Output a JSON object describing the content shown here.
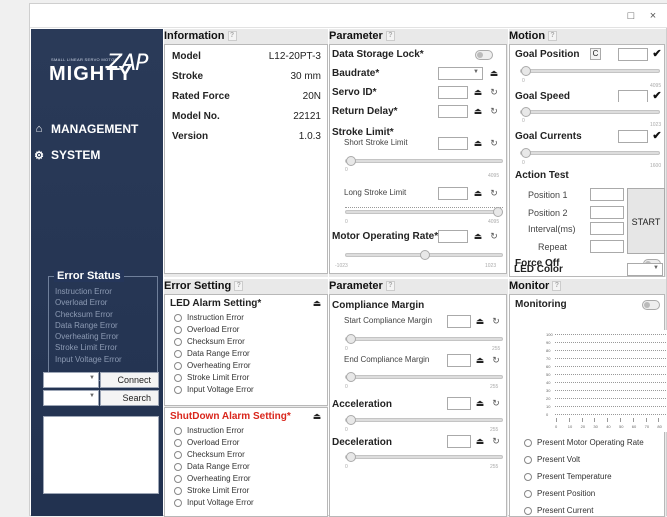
{
  "window": {
    "maximize_icon": "□",
    "close_icon": "×"
  },
  "sidebar": {
    "logo_small": "SMALL LINEAR SERVO MOTOR",
    "logo_text": "MIGHTY",
    "logo_zap": "ZAP",
    "nav": [
      {
        "label": "MANAGEMENT",
        "icon": "home-icon",
        "glyph": "⌂"
      },
      {
        "label": "SYSTEM",
        "icon": "gears-icon",
        "glyph": "⚙"
      }
    ],
    "error_status": {
      "title": "Error Status",
      "items": [
        "Instruction Error",
        "Overload Error",
        "Checksum Error",
        "Data Range Error",
        "Overheating Error",
        "Stroke Limit Error",
        "Input Voltage Error"
      ]
    },
    "connect_label": "Connect",
    "search_label": "Search"
  },
  "information": {
    "title": "Information",
    "rows": [
      {
        "label": "Model",
        "value": "L12-20PT-3"
      },
      {
        "label": "Stroke",
        "value": "30 mm"
      },
      {
        "label": "Rated Force",
        "value": "20N"
      },
      {
        "label": "Model No.",
        "value": "22121"
      },
      {
        "label": "Version",
        "value": "1.0.3"
      }
    ]
  },
  "parameter1": {
    "title": "Parameter",
    "data_storage_lock": "Data Storage Lock*",
    "baudrate": "Baudrate*",
    "servo_id": "Servo ID*",
    "return_delay": "Return Delay*",
    "stroke_limit": "Stroke Limit*",
    "short_stroke_limit": "Short Stroke Limit",
    "long_stroke_limit": "Long Stroke Limit",
    "motor_operating_rate": "Motor Operating Rate*",
    "short_min": "0",
    "short_max": "4095",
    "long_min": "0",
    "long_max": "4095",
    "mor_min": "-1023",
    "mor_max": "1023"
  },
  "motion": {
    "title": "Motion",
    "goal_position": "Goal Position",
    "goal_position_btn": "C",
    "goal_position_min": "0",
    "goal_position_max": "4095",
    "goal_speed": "Goal Speed",
    "goal_speed_min": "0",
    "goal_speed_max": "1023",
    "goal_currents": "Goal Currents",
    "goal_currents_min": "0",
    "goal_currents_max": "1600",
    "action_test": "Action Test",
    "position1": "Position 1",
    "position2": "Position 2",
    "interval": "Interval(ms)",
    "repeat": "Repeat",
    "start": "START",
    "force_off": "Force Off",
    "led_color": "LED Color"
  },
  "error_setting": {
    "title": "Error Setting",
    "led_alarm": "LED Alarm Setting*",
    "led_items": [
      "Instruction Error",
      "Overload Error",
      "Checksum Error",
      "Data Range Error",
      "Overheating Error",
      "Stroke Limit  Error",
      "Input Voltage Error"
    ],
    "shutdown_alarm": "ShutDown Alarm Setting*",
    "shutdown_items": [
      "Instruction Error",
      "Overload Error",
      "Checksum Error",
      "Data Range Error",
      "Overheating Error",
      "Stroke Limit  Error",
      "Input Voltage Error"
    ]
  },
  "parameter2": {
    "title": "Parameter",
    "compliance_margin": "Compliance Margin",
    "start_compliance": "Start Compliance Margin",
    "end_compliance": "End Compliance Margin",
    "start_min": "0",
    "start_max": "255",
    "end_min": "0",
    "end_max": "255",
    "acceleration": "Acceleration",
    "acc_min": "0",
    "acc_max": "255",
    "deceleration": "Deceleration",
    "dec_min": "0",
    "dec_max": "255"
  },
  "monitor": {
    "title": "Monitor",
    "monitoring": "Monitoring",
    "y_ticks": [
      "100",
      "90",
      "80",
      "70",
      "60",
      "50",
      "40",
      "30",
      "20",
      "10",
      "0"
    ],
    "x_ticks": [
      "0",
      "10",
      "20",
      "30",
      "40",
      "50",
      "60",
      "70",
      "80",
      "90",
      "100"
    ],
    "options": [
      "Present Motor Operating Rate",
      "Present Volt",
      "Present Temperature",
      "Present Position",
      "Present Current"
    ]
  }
}
